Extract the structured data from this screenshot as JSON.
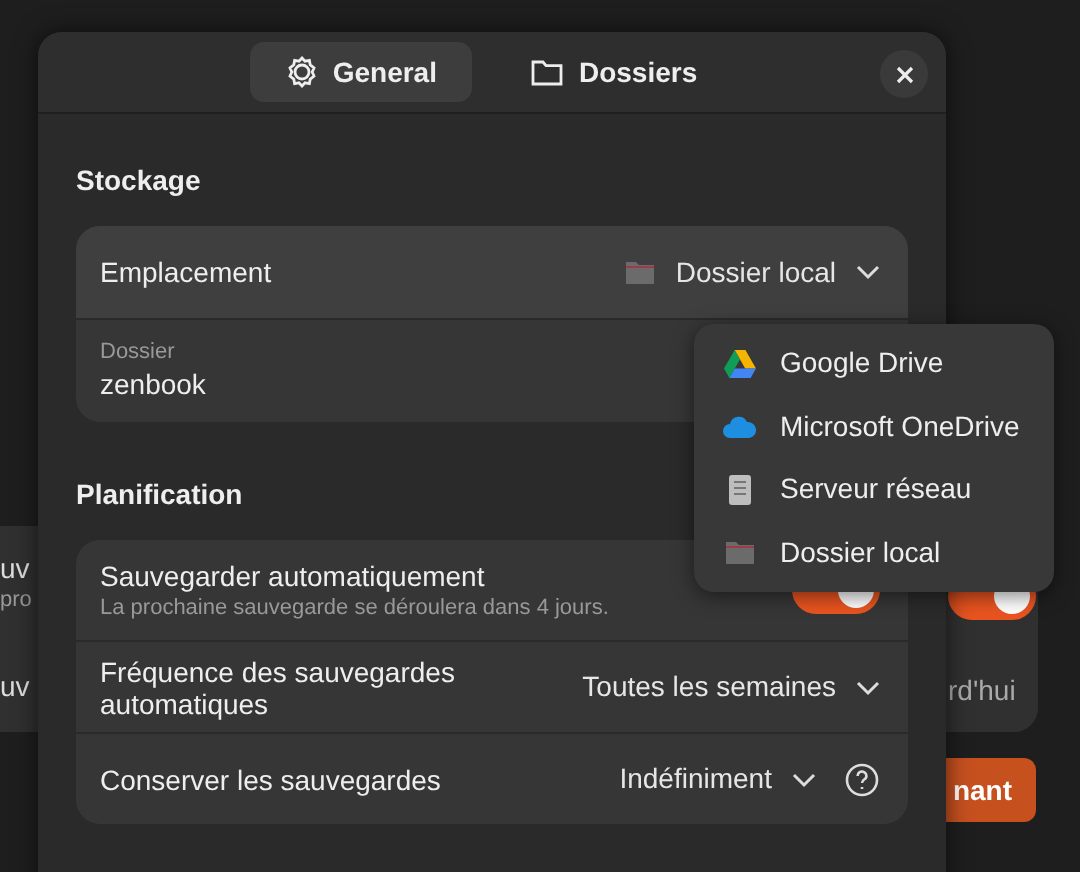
{
  "background_window": {
    "rows": [
      {
        "title": "uv",
        "subtitle": "pro"
      },
      {
        "title": "uv"
      }
    ],
    "toggle": {
      "on": true
    },
    "row_value": "rd'hui",
    "button": "nant"
  },
  "dialog": {
    "tabs": [
      {
        "label": "General",
        "kind": "gear",
        "selected": true
      },
      {
        "label": "Dossiers",
        "kind": "folder",
        "selected": false
      }
    ],
    "sections": [
      {
        "title": "Stockage",
        "rows": [
          {
            "kind": "dropdown",
            "label": "Emplacement",
            "value": "Dossier local"
          },
          {
            "kind": "entry",
            "label": "Dossier",
            "value": "zenbook"
          }
        ]
      },
      {
        "title": "Planification",
        "rows": [
          {
            "kind": "switch",
            "label": "Sauvegarder automatiquement",
            "subtitle": "La prochaine sauvegarde se déroulera dans 4 jours.",
            "on": true
          },
          {
            "kind": "dropdown",
            "label": "Fréquence des sauvegardes automatiques",
            "value": "Toutes les semaines"
          },
          {
            "kind": "dropdown",
            "label": "Conserver les sauvegardes",
            "value": "Indéfiniment",
            "help": true
          }
        ]
      }
    ]
  },
  "location_menu": [
    {
      "label": "Google Drive",
      "kind": "gdrive"
    },
    {
      "label": "Microsoft OneDrive",
      "kind": "onedrive"
    },
    {
      "label": "Serveur réseau",
      "kind": "network"
    },
    {
      "label": "Dossier local",
      "kind": "folder"
    }
  ]
}
